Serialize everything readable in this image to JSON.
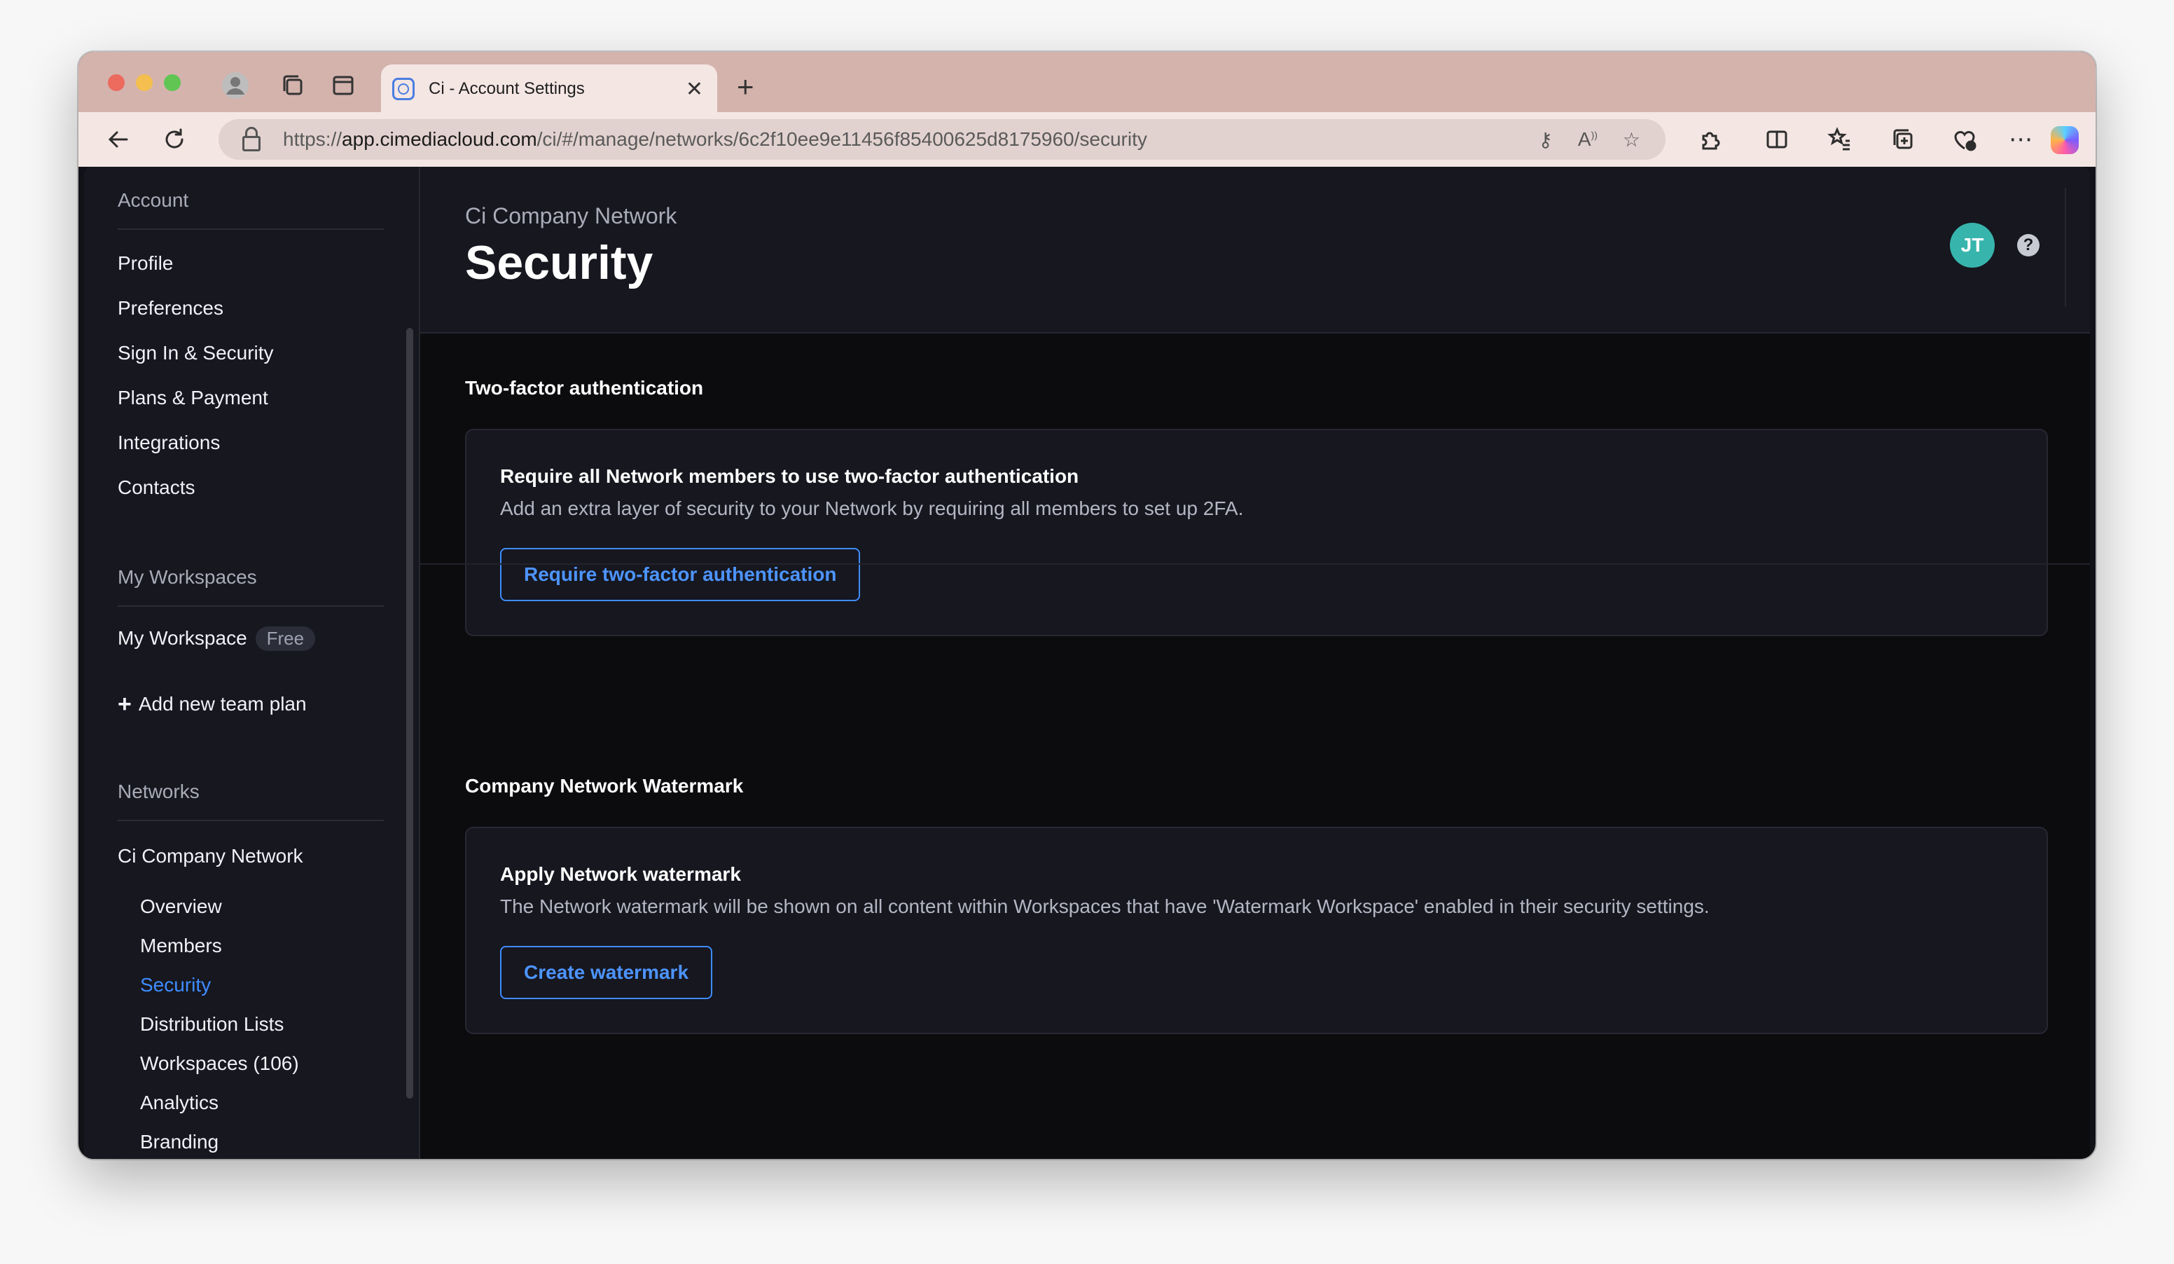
{
  "browser": {
    "tab_title": "Ci - Account Settings",
    "url_prefix": "https://",
    "url_host": "app.cimediacloud.com",
    "url_path": "/ci/#/manage/networks/6c2f10ee9e11456f85400625d8175960/security"
  },
  "sidebar": {
    "account_heading": "Account",
    "account_items": [
      "Profile",
      "Preferences",
      "Sign In & Security",
      "Plans & Payment",
      "Integrations",
      "Contacts"
    ],
    "workspaces_heading": "My Workspaces",
    "workspace_name": "My Workspace",
    "workspace_badge": "Free",
    "add_plan_label": "Add new team plan",
    "networks_heading": "Networks",
    "network_name": "Ci Company Network",
    "network_items": [
      "Overview",
      "Members",
      "Security",
      "Distribution Lists",
      "Workspaces (106)",
      "Analytics",
      "Branding"
    ],
    "active_item": "Security"
  },
  "header": {
    "breadcrumb": "Ci Company Network",
    "title": "Security",
    "avatar_initials": "JT",
    "help_glyph": "?"
  },
  "two_factor": {
    "section_title": "Two-factor authentication",
    "card_title": "Require all Network members to use two-factor authentication",
    "card_desc": "Add an extra layer of security to your Network by requiring all members to set up 2FA.",
    "button_label": "Require two-factor authentication"
  },
  "watermark": {
    "section_title": "Company Network Watermark",
    "card_title": "Apply Network watermark",
    "card_desc": "The Network watermark will be shown on all content within Workspaces that have 'Watermark Workspace' enabled in their security settings.",
    "button_label": "Create watermark"
  },
  "colors": {
    "accent": "#3f8cff",
    "avatar": "#37b5ad",
    "page_bg": "#0c0c0f",
    "panel_bg": "#16171f",
    "tab_strip": "#d4b3ad"
  }
}
